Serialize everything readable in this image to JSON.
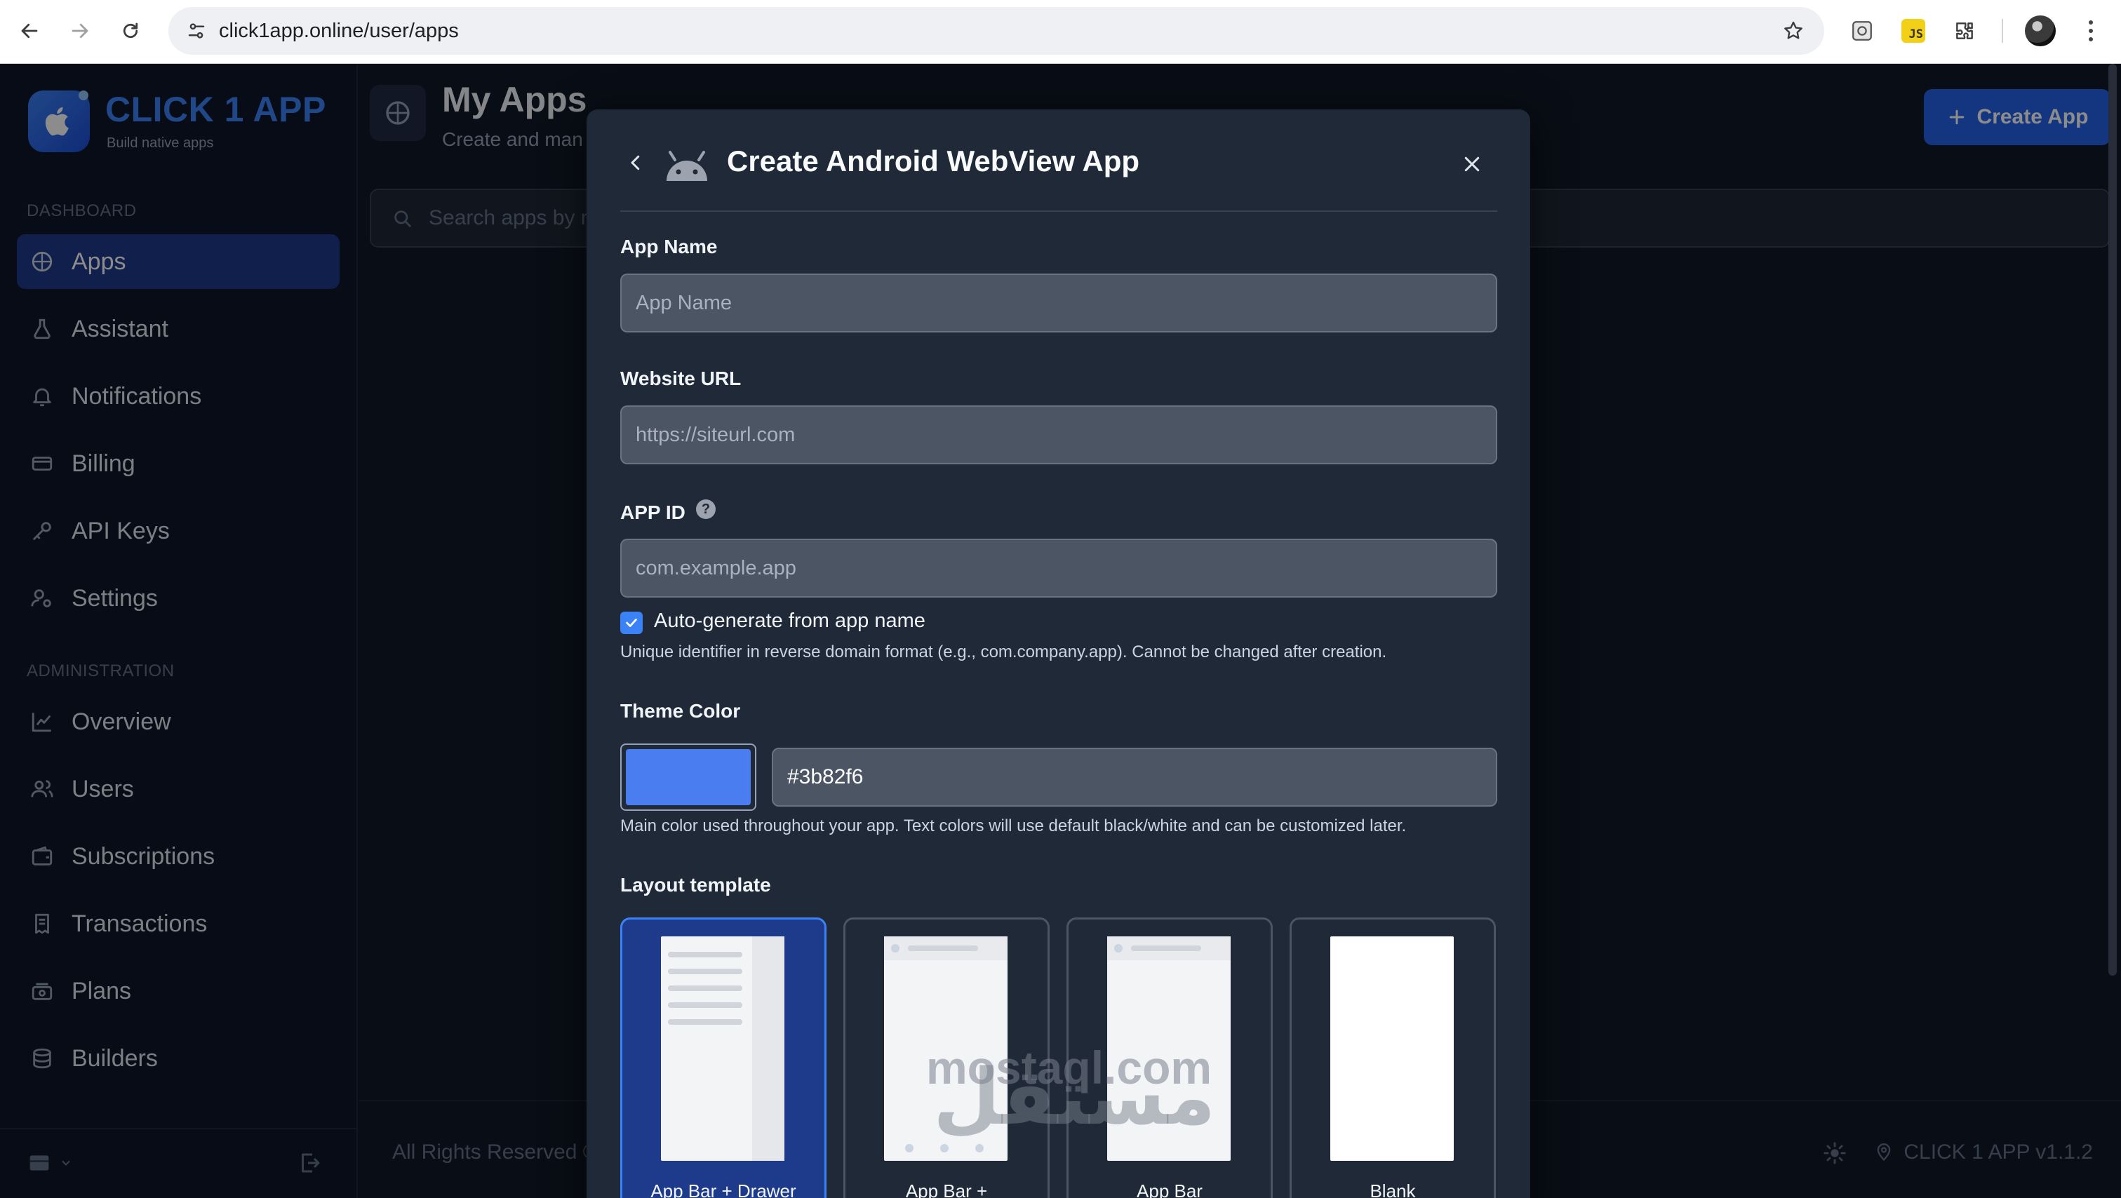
{
  "browser": {
    "url": "click1app.online/user/apps",
    "ext_js_label": "JS"
  },
  "sidebar": {
    "brand": "CLICK 1 APP",
    "tagline": "Build native apps",
    "section_dashboard": "DASHBOARD",
    "section_admin": "ADMINISTRATION",
    "dashboard_items": [
      {
        "label": "Apps",
        "icon": "apps-icon",
        "active": true
      },
      {
        "label": "Assistant",
        "icon": "flask-icon"
      },
      {
        "label": "Notifications",
        "icon": "bell-icon"
      },
      {
        "label": "Billing",
        "icon": "card-icon"
      },
      {
        "label": "API Keys",
        "icon": "key-icon"
      },
      {
        "label": "Settings",
        "icon": "settings-icon"
      }
    ],
    "admin_items": [
      {
        "label": "Overview",
        "icon": "chart-icon"
      },
      {
        "label": "Users",
        "icon": "users-icon"
      },
      {
        "label": "Subscriptions",
        "icon": "wallet-icon"
      },
      {
        "label": "Transactions",
        "icon": "receipt-icon"
      },
      {
        "label": "Plans",
        "icon": "plans-icon"
      },
      {
        "label": "Builders",
        "icon": "database-icon"
      }
    ]
  },
  "main": {
    "title": "My Apps",
    "subtitle": "Create and man",
    "create_button": "Create App",
    "search_placeholder": "Search apps by n",
    "footer_text": "All Rights Reserved ©",
    "version": "CLICK 1 APP v1.1.2"
  },
  "modal": {
    "title": "Create Android WebView App",
    "app_name_label": "App Name",
    "app_name_placeholder": "App Name",
    "website_url_label": "Website URL",
    "website_url_placeholder": "https://siteurl.com",
    "app_id_label": "APP ID",
    "app_id_help": "?",
    "app_id_placeholder": "com.example.app",
    "autogen_label": "Auto-generate from app name",
    "autogen_checked": true,
    "app_id_hint": "Unique identifier in reverse domain format (e.g., com.company.app). Cannot be changed after creation.",
    "theme_color_label": "Theme Color",
    "theme_color_value": "#3b82f6",
    "theme_color_swatch": "#4a7ef0",
    "theme_hint": "Main color used throughout your app. Text colors will use default black/white and can be customized later.",
    "layout_label": "Layout template",
    "templates": [
      {
        "label": "App Bar + Drawer",
        "selected": true
      },
      {
        "label": "App Bar +"
      },
      {
        "label": "App Bar"
      },
      {
        "label": "Blank"
      }
    ]
  },
  "watermark": {
    "latin": "mostaql.com",
    "arabic": "مستقل"
  },
  "colors": {
    "accent": "#3b82f6",
    "sidebar_active": "#1e3a8a",
    "modal_bg": "#1f2937"
  }
}
